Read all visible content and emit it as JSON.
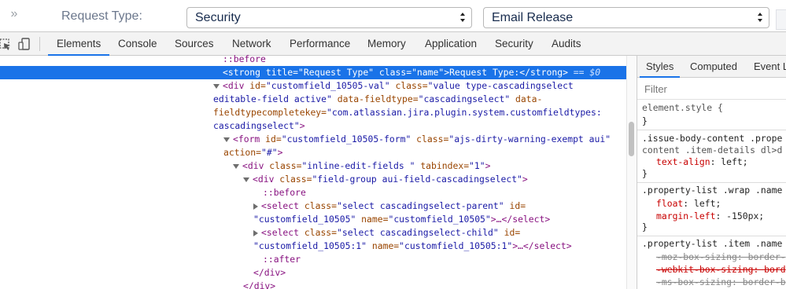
{
  "page": {
    "request_type_label": "Request Type:",
    "select1_value": "Security",
    "select2_value": "Email Release"
  },
  "devtools": {
    "tabs": [
      "Elements",
      "Console",
      "Sources",
      "Network",
      "Performance",
      "Memory",
      "Application",
      "Security",
      "Audits"
    ],
    "active_tab": "Elements"
  },
  "dom": {
    "l1_pseudo": "::before",
    "l2_tag_open": "<strong",
    "l2_attr1_name": " title=",
    "l2_attr1_val": "\"Request Type\"",
    "l2_attr2_name": " class=",
    "l2_attr2_val": "\"name\"",
    "l2_text": ">Request Type:</strong>",
    "l2_marker": " == $0",
    "l3_tag": "<div",
    "l3_a1n": " id=",
    "l3_a1v": "\"customfield_10505-val\"",
    "l3_a2n": " class=",
    "l3_a2v": "\"value type-cascadingselect",
    "l4_a2v_cont": "editable-field active\"",
    "l4_a3n": " data-fieldtype=",
    "l4_a3v": "\"cascadingselect\"",
    "l4_a4n": " data-",
    "l5_a4n_cont": "fieldtypecompletekey=",
    "l5_a4v": "\"com.atlassian.jira.plugin.system.customfieldtypes:",
    "l6_a4v_cont": "cascadingselect\"",
    "l6_close": ">",
    "l7_tag": "<form",
    "l7_a1n": " id=",
    "l7_a1v": "\"customfield_10505-form\"",
    "l7_a2n": " class=",
    "l7_a2v": "\"ajs-dirty-warning-exempt aui\"",
    "l8_a3n": "action=",
    "l8_a3v": "\"#\"",
    "l8_close": ">",
    "l9_tag": "<div",
    "l9_a1n": " class=",
    "l9_a1v": "\"inline-edit-fields \"",
    "l9_a2n": " tabindex=",
    "l9_a2v": "\"1\"",
    "l9_close": ">",
    "l10_tag": "<div",
    "l10_a1n": " class=",
    "l10_a1v": "\"field-group aui-field-cascadingselect\"",
    "l10_close": ">",
    "l11_pseudo": "::before",
    "l12_tag": "<select",
    "l12_a1n": " class=",
    "l12_a1v": "\"select cascadingselect-parent\"",
    "l12_a2n": " id=",
    "l13_a2v": "\"customfield_10505\"",
    "l13_a3n": " name=",
    "l13_a3v": "\"customfield_10505\"",
    "l13_close": ">…</select>",
    "l14_tag": "<select",
    "l14_a1n": " class=",
    "l14_a1v": "\"select cascadingselect-child\"",
    "l14_a2n": " id=",
    "l15_a2v": "\"customfield_10505:1\"",
    "l15_a3n": " name=",
    "l15_a3v": "\"customfield_10505:1\"",
    "l15_close": ">…</select>",
    "l16_pseudo": "::after",
    "l17_close": "</div>",
    "l18_close": "</div>"
  },
  "styles": {
    "tabs": [
      "Styles",
      "Computed",
      "Event L"
    ],
    "active_tab": "Styles",
    "filter_placeholder": "Filter",
    "r1_selector": "element.style {",
    "r1_close": "}",
    "r2_selector": ".issue-body-content .prope",
    "r2_selector_cont": "content .item-details dl>d",
    "r2_prop": "text-align",
    "r2_val": ": left;",
    "r2_close": "}",
    "r3_selector": ".property-list .wrap .name",
    "r3_p1": "float",
    "r3_v1": ": left;",
    "r3_p2": "margin-left",
    "r3_v2": ": -150px;",
    "r3_close": "}",
    "r4_selector": ".property-list .item .name",
    "r4_s1": "-moz-box-sizing: border-",
    "r4_s2": "-webkit-box-sizing: bord",
    "r4_s3": "-ms-box-sizing: border-b"
  },
  "colors": {
    "selected_row": "#1a73e8",
    "tag": "#881280",
    "attr_name": "#994500",
    "attr_value": "#1a1aa6",
    "css_property": "#c80000"
  },
  "icons": [
    "expand-sidebar-icon",
    "inspect-element-icon",
    "device-toolbar-icon",
    "select-arrows-icon"
  ]
}
